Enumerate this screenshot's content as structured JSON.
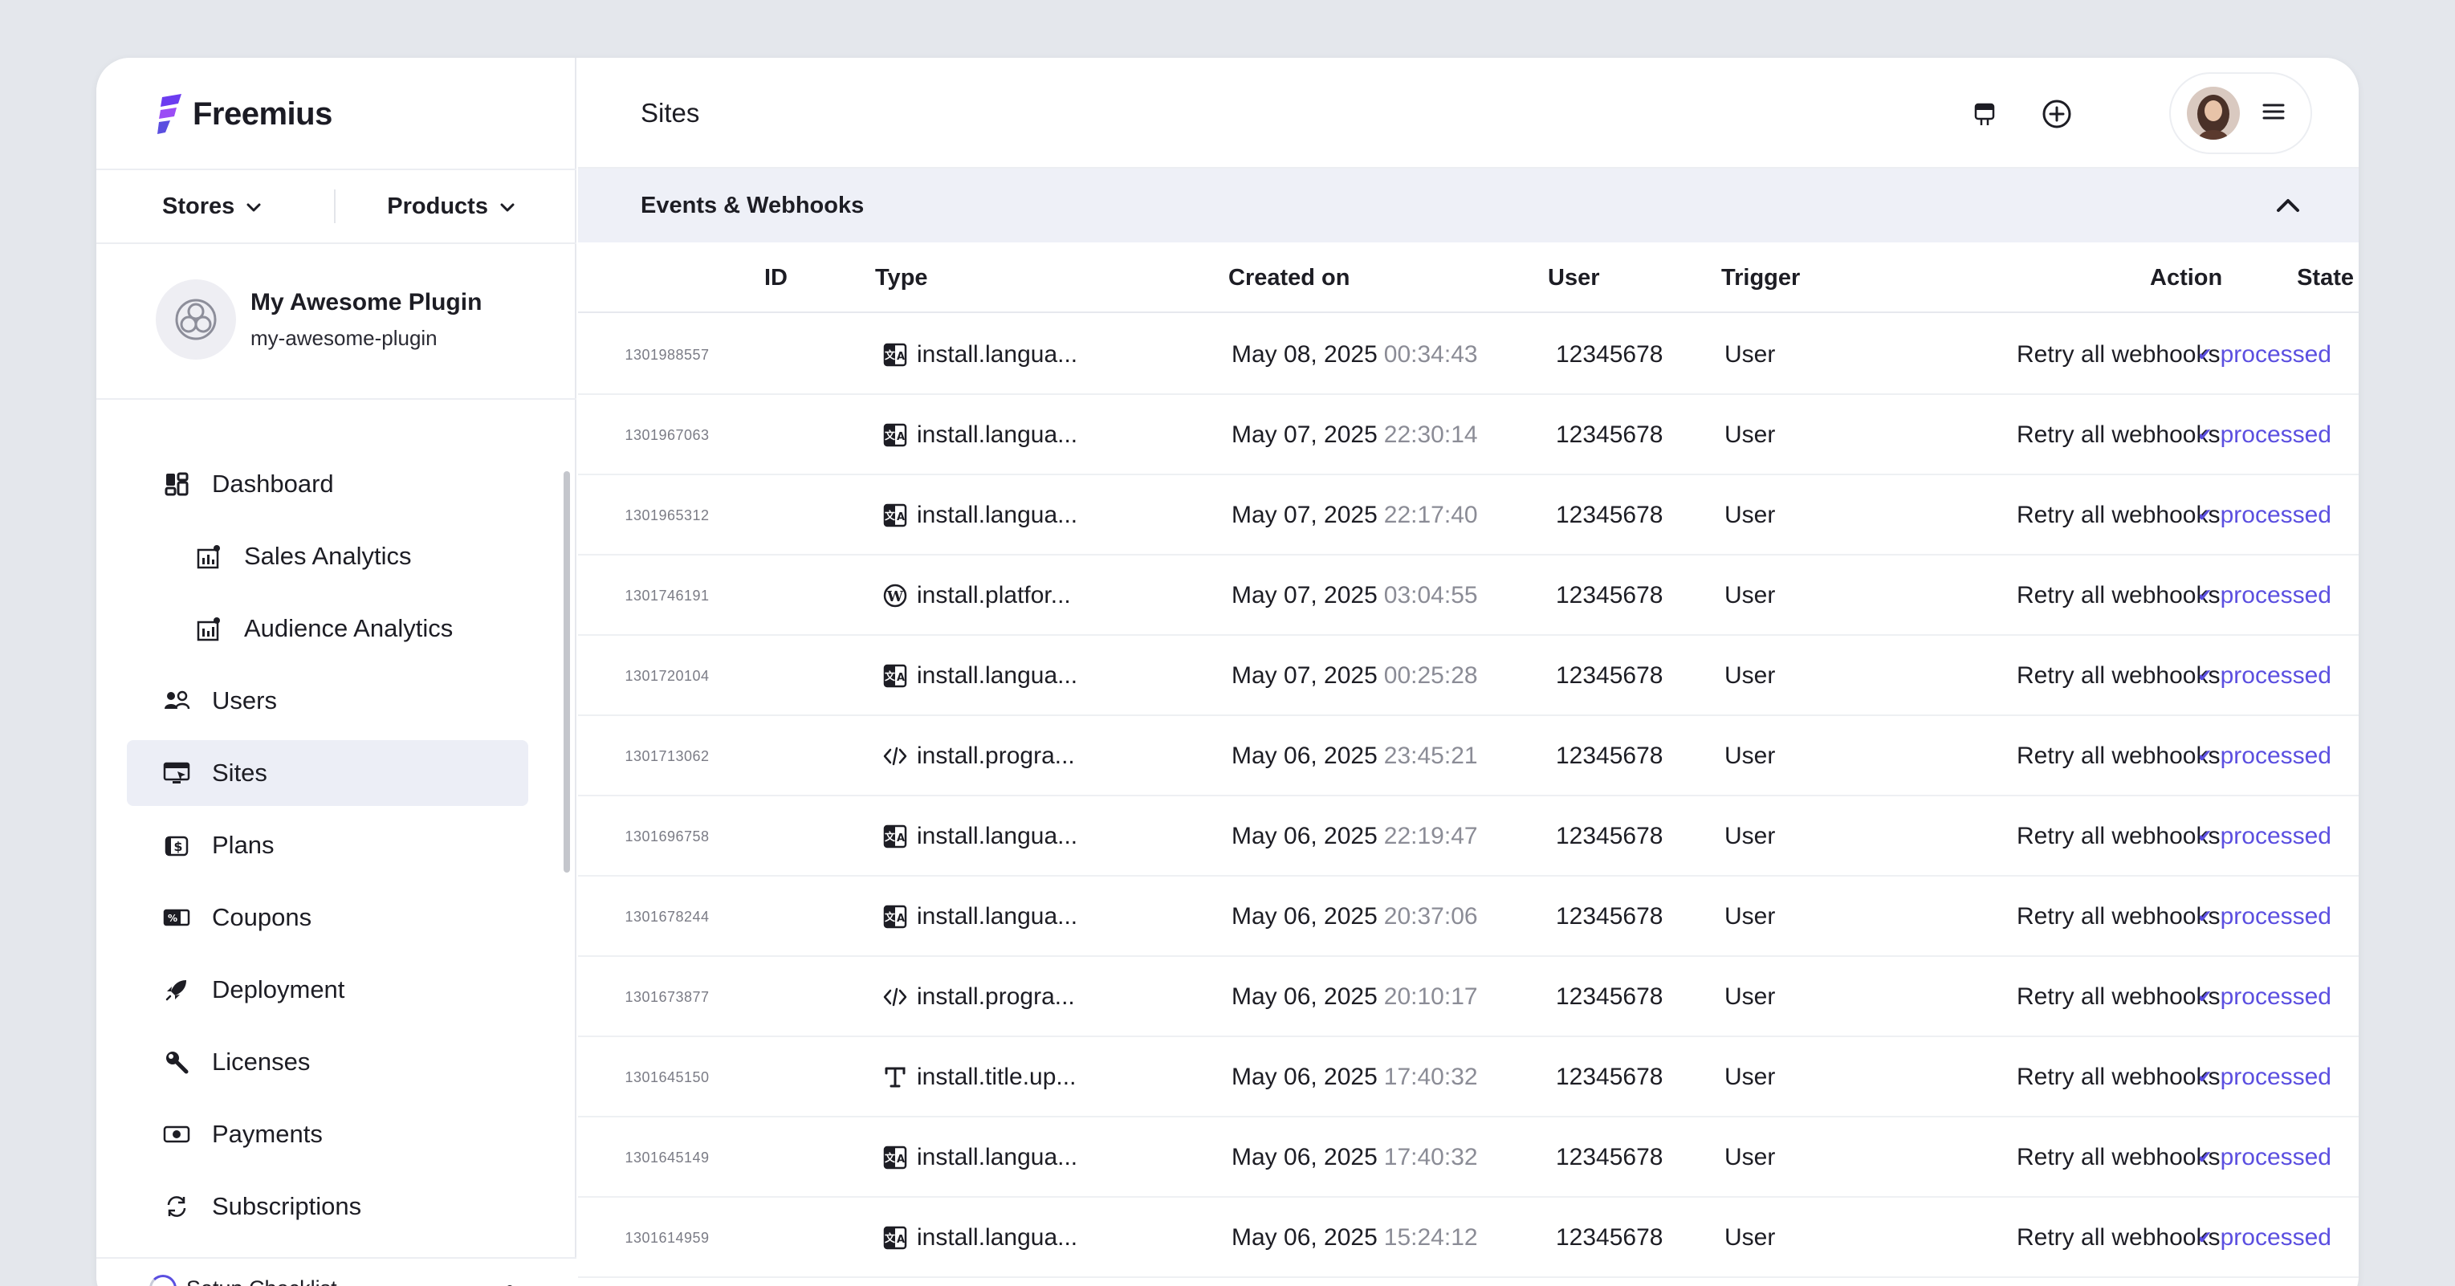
{
  "brand": {
    "name": "Freemius",
    "accent": "#5b4fe0"
  },
  "switcher": {
    "stores_label": "Stores",
    "products_label": "Products"
  },
  "product": {
    "name": "My Awesome Plugin",
    "slug": "my-awesome-plugin"
  },
  "nav": {
    "dashboard": "Dashboard",
    "sales_analytics": "Sales Analytics",
    "audience_analytics": "Audience Analytics",
    "users": "Users",
    "sites": "Sites",
    "plans": "Plans",
    "coupons": "Coupons",
    "deployment": "Deployment",
    "licenses": "Licenses",
    "payments": "Payments",
    "subscriptions": "Subscriptions"
  },
  "footer": {
    "setup_label": "Setup Checklist"
  },
  "header": {
    "title": "Sites"
  },
  "section": {
    "title": "Events & Webhooks"
  },
  "columns": {
    "id": "ID",
    "type": "Type",
    "created_on": "Created on",
    "user": "User",
    "trigger": "Trigger",
    "action": "Action",
    "state": "State"
  },
  "rows": [
    {
      "id": "1301988557",
      "type_icon": "language-icon",
      "type": "install.langua...",
      "date": "May 08, 2025",
      "time": "00:34:43",
      "user": "12345678",
      "trigger": "User",
      "action": "Retry all webhooks",
      "state": "processed"
    },
    {
      "id": "1301967063",
      "type_icon": "language-icon",
      "type": "install.langua...",
      "date": "May 07, 2025",
      "time": "22:30:14",
      "user": "12345678",
      "trigger": "User",
      "action": "Retry all webhooks",
      "state": "processed"
    },
    {
      "id": "1301965312",
      "type_icon": "language-icon",
      "type": "install.langua...",
      "date": "May 07, 2025",
      "time": "22:17:40",
      "user": "12345678",
      "trigger": "User",
      "action": "Retry all webhooks",
      "state": "processed"
    },
    {
      "id": "1301746191",
      "type_icon": "wordpress-icon",
      "type": "install.platfor...",
      "date": "May 07, 2025",
      "time": "03:04:55",
      "user": "12345678",
      "trigger": "User",
      "action": "Retry all webhooks",
      "state": "processed"
    },
    {
      "id": "1301720104",
      "type_icon": "language-icon",
      "type": "install.langua...",
      "date": "May 07, 2025",
      "time": "00:25:28",
      "user": "12345678",
      "trigger": "User",
      "action": "Retry all webhooks",
      "state": "processed"
    },
    {
      "id": "1301713062",
      "type_icon": "code-icon",
      "type": "install.progra...",
      "date": "May 06, 2025",
      "time": "23:45:21",
      "user": "12345678",
      "trigger": "User",
      "action": "Retry all webhooks",
      "state": "processed"
    },
    {
      "id": "1301696758",
      "type_icon": "language-icon",
      "type": "install.langua...",
      "date": "May 06, 2025",
      "time": "22:19:47",
      "user": "12345678",
      "trigger": "User",
      "action": "Retry all webhooks",
      "state": "processed"
    },
    {
      "id": "1301678244",
      "type_icon": "language-icon",
      "type": "install.langua...",
      "date": "May 06, 2025",
      "time": "20:37:06",
      "user": "12345678",
      "trigger": "User",
      "action": "Retry all webhooks",
      "state": "processed"
    },
    {
      "id": "1301673877",
      "type_icon": "code-icon",
      "type": "install.progra...",
      "date": "May 06, 2025",
      "time": "20:10:17",
      "user": "12345678",
      "trigger": "User",
      "action": "Retry all webhooks",
      "state": "processed"
    },
    {
      "id": "1301645150",
      "type_icon": "title-icon",
      "type": "install.title.up...",
      "date": "May 06, 2025",
      "time": "17:40:32",
      "user": "12345678",
      "trigger": "User",
      "action": "Retry all webhooks",
      "state": "processed"
    },
    {
      "id": "1301645149",
      "type_icon": "language-icon",
      "type": "install.langua...",
      "date": "May 06, 2025",
      "time": "17:40:32",
      "user": "12345678",
      "trigger": "User",
      "action": "Retry all webhooks",
      "state": "processed"
    },
    {
      "id": "1301614959",
      "type_icon": "language-icon",
      "type": "install.langua...",
      "date": "May 06, 2025",
      "time": "15:24:12",
      "user": "12345678",
      "trigger": "User",
      "action": "Retry all webhooks",
      "state": "processed"
    }
  ]
}
